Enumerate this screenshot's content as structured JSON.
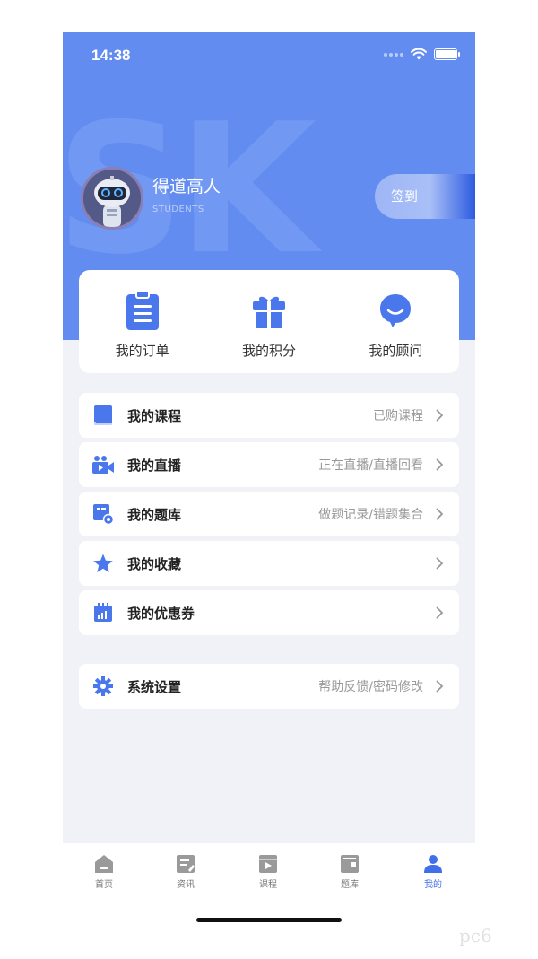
{
  "status": {
    "time": "14:38"
  },
  "header": {
    "watermark": "SK"
  },
  "profile": {
    "name": "得道高人",
    "subtitle": "STUDENTS",
    "signin_label": "签到"
  },
  "quick_actions": [
    {
      "label": "我的订单",
      "icon": "clipboard-icon"
    },
    {
      "label": "我的积分",
      "icon": "gift-icon"
    },
    {
      "label": "我的顾问",
      "icon": "chat-bubble-icon"
    }
  ],
  "menu": [
    {
      "label": "我的课程",
      "detail": "已购课程",
      "icon": "book-icon"
    },
    {
      "label": "我的直播",
      "detail": "正在直播/直播回看",
      "icon": "video-camera-icon"
    },
    {
      "label": "我的题库",
      "detail": "做题记录/错题集合",
      "icon": "question-bank-icon"
    },
    {
      "label": "我的收藏",
      "detail": "",
      "icon": "star-icon"
    },
    {
      "label": "我的优惠券",
      "detail": "",
      "icon": "calendar-coupon-icon"
    }
  ],
  "settings": {
    "label": "系统设置",
    "detail": "帮助反馈/密码修改",
    "icon": "gear-icon"
  },
  "tabs": [
    {
      "label": "首页",
      "icon": "home-icon"
    },
    {
      "label": "资讯",
      "icon": "news-icon"
    },
    {
      "label": "课程",
      "icon": "play-video-icon"
    },
    {
      "label": "题库",
      "icon": "question-bank-tab-icon"
    },
    {
      "label": "我的",
      "icon": "person-icon",
      "active": true
    }
  ],
  "colors": {
    "primary": "#638cf0",
    "accent": "#3f6fe9",
    "background": "#f1f2f7"
  },
  "watermark_logo": "pc6"
}
